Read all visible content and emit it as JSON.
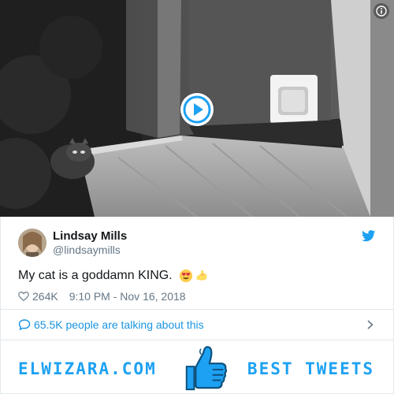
{
  "media": {
    "icons": {
      "info": "info-icon",
      "play": "play-icon"
    }
  },
  "tweet": {
    "author_name": "Lindsay Mills",
    "author_handle": "@lindsaymills",
    "text": "My cat is a goddamn KING.",
    "emojis": [
      "heart-eyes-emoji",
      "flexed-biceps-emoji"
    ],
    "likes": "264K",
    "timestamp": "9:10 PM - Nov 16, 2018",
    "icons": {
      "platform": "bird-icon",
      "like": "heart-icon"
    }
  },
  "conversation": {
    "label": "65.5K people are talking about this",
    "icons": {
      "bubble": "speech-bubble-icon",
      "chevron": "chevron-right-icon"
    }
  },
  "banner": {
    "left_text": "ELWIZARA.COM",
    "right_text": "BEST TWEETS",
    "icon": "thumbs-up-icon"
  },
  "colors": {
    "accent": "#1da1f2",
    "link": "#1b95e0",
    "muted": "#657786",
    "text": "#14171a",
    "border": "#e1e8ed"
  }
}
